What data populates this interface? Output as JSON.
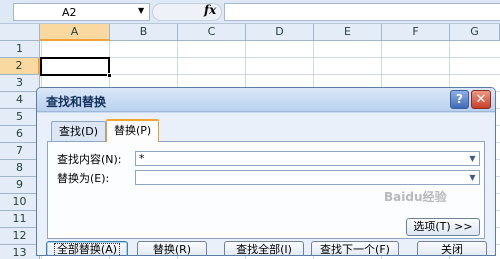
{
  "formula_bar": {
    "name_box": "A2",
    "name_dropdown": "▼",
    "fx_label": "fx",
    "formula": ""
  },
  "grid": {
    "columns": [
      "A",
      "B",
      "C",
      "D",
      "E",
      "F",
      "G"
    ],
    "rows": [
      "1",
      "2",
      "3",
      "4",
      "5",
      "6",
      "7",
      "8",
      "9",
      "10",
      "11",
      "12",
      "13"
    ]
  },
  "dialog": {
    "title": "查找和替换",
    "help_glyph": "?",
    "close_glyph": "✕",
    "tabs": [
      "查找(D)",
      "替换(P)"
    ],
    "find_label": "查找内容(N):",
    "find_value": "*",
    "replace_label": "替换为(E):",
    "replace_value": "",
    "options_button": "选项(T) >>",
    "buttons": {
      "replace_all": "全部替换(A)",
      "replace": "替换(R)",
      "find_all": "查找全部(I)",
      "find_next": "查找下一个(F)",
      "close": "关闭"
    }
  },
  "watermark": "Baidu经验"
}
